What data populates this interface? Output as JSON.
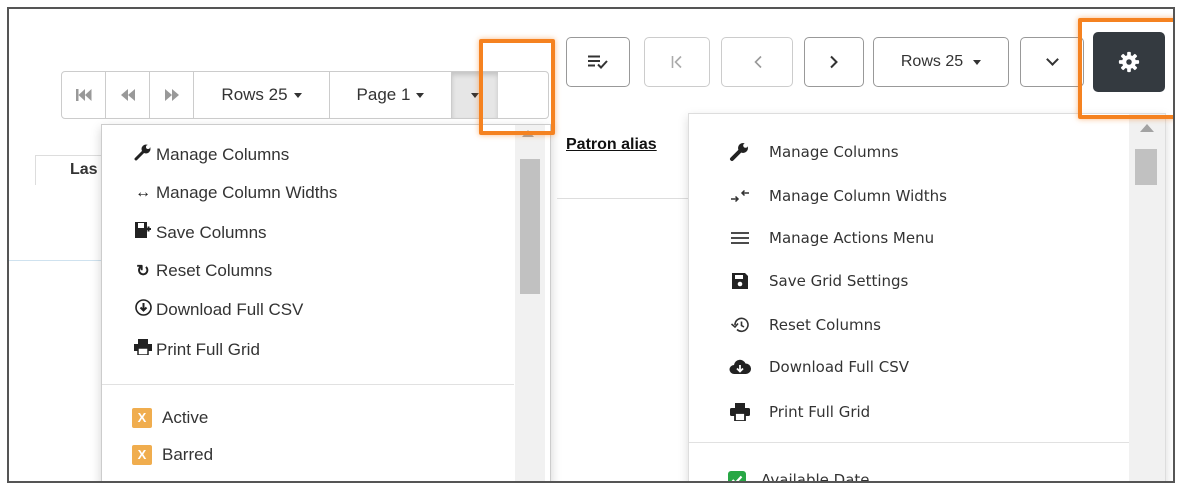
{
  "old_grid": {
    "pager": {
      "first_icon": "first-page-icon",
      "prev_icon": "rewind-icon",
      "next_icon": "fast-forward-icon",
      "rows_label": "Rows 25",
      "page_label": "Page 1",
      "dropdown_icon": "caret-down-icon"
    },
    "header_fragment": "Las",
    "menu": {
      "items": [
        {
          "icon": "wrench-icon",
          "label": "Manage Columns"
        },
        {
          "icon": "arrows-horizontal-icon",
          "label": "Manage Column Widths"
        },
        {
          "icon": "save-columns-icon",
          "label": "Save Columns"
        },
        {
          "icon": "refresh-icon",
          "label": "Reset Columns"
        },
        {
          "icon": "download-circle-icon",
          "label": "Download Full CSV"
        },
        {
          "icon": "print-icon",
          "label": "Print Full Grid"
        }
      ],
      "columns": [
        {
          "mark": "X",
          "label": "Active"
        },
        {
          "mark": "X",
          "label": "Barred"
        }
      ]
    }
  },
  "new_grid": {
    "toolbar": {
      "actions_icon": "list-check-icon",
      "first_icon": "first-page-icon",
      "prev_icon": "chevron-left-icon",
      "next_icon": "chevron-right-icon",
      "rows_label": "Rows 25",
      "more_icon": "chevron-down-icon",
      "settings_icon": "gear-icon"
    },
    "header_label": "Patron alias",
    "menu": {
      "items": [
        {
          "icon": "wrench-icon",
          "label": "Manage Columns"
        },
        {
          "icon": "resize-arrows-icon",
          "label": "Manage Column Widths"
        },
        {
          "icon": "bars-icon",
          "label": "Manage Actions Menu"
        },
        {
          "icon": "floppy-disk-icon",
          "label": "Save Grid Settings"
        },
        {
          "icon": "history-icon",
          "label": "Reset Columns"
        },
        {
          "icon": "cloud-download-icon",
          "label": "Download Full CSV"
        },
        {
          "icon": "print-icon",
          "label": "Print Full Grid"
        }
      ],
      "columns": [
        {
          "checked": true,
          "label": "Available Date"
        }
      ]
    }
  },
  "colors": {
    "highlight": "#f58220",
    "badge_x": "#f0ad4e",
    "badge_check": "#28a745",
    "settings_button": "#343a40"
  }
}
